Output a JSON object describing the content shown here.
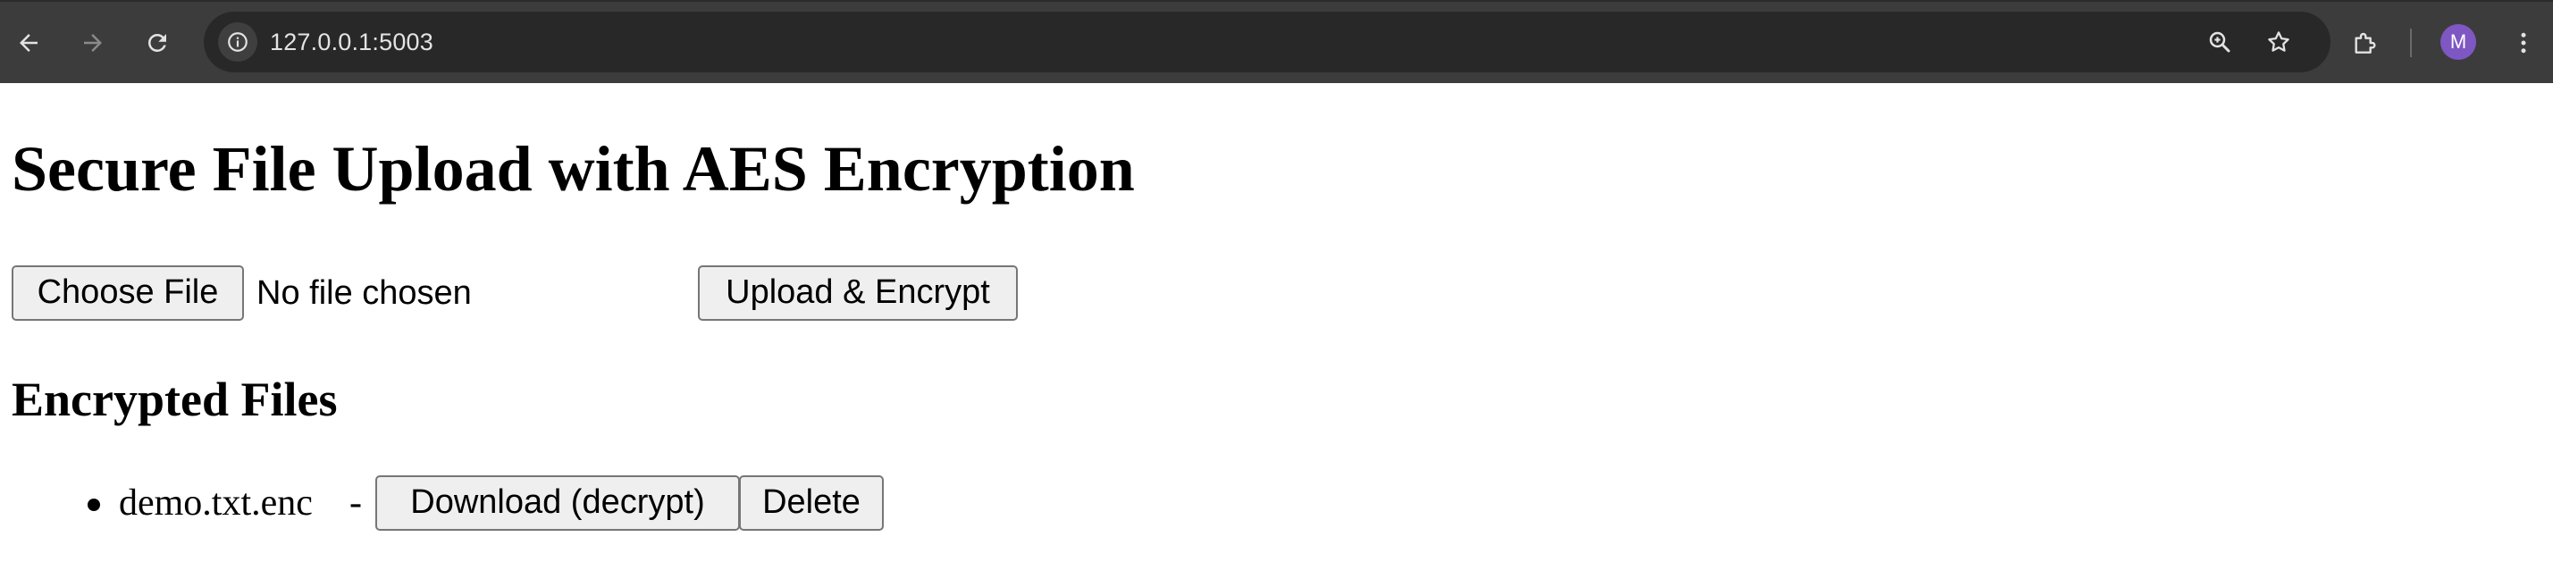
{
  "browser": {
    "url": "127.0.0.1:5003",
    "profile_initial": "M",
    "icons": {
      "back": "arrow-left-icon",
      "forward": "arrow-right-icon",
      "reload": "reload-icon",
      "site_info": "info-icon",
      "zoom": "zoom-icon",
      "bookmark": "star-icon",
      "extensions": "puzzle-icon",
      "menu": "kebab-menu-icon"
    },
    "colors": {
      "toolbar": "#3c3c3c",
      "omnibox": "#282828",
      "avatar": "#7e57c2"
    }
  },
  "page": {
    "title": "Secure File Upload with AES Encryption",
    "upload": {
      "choose_label": "Choose File",
      "file_status": "No file chosen",
      "submit_label": "Upload & Encrypt"
    },
    "files_heading": "Encrypted Files",
    "files": [
      {
        "name": "demo.txt.enc",
        "separator": "-",
        "download_label": "Download (decrypt)",
        "delete_label": "Delete"
      }
    ]
  }
}
